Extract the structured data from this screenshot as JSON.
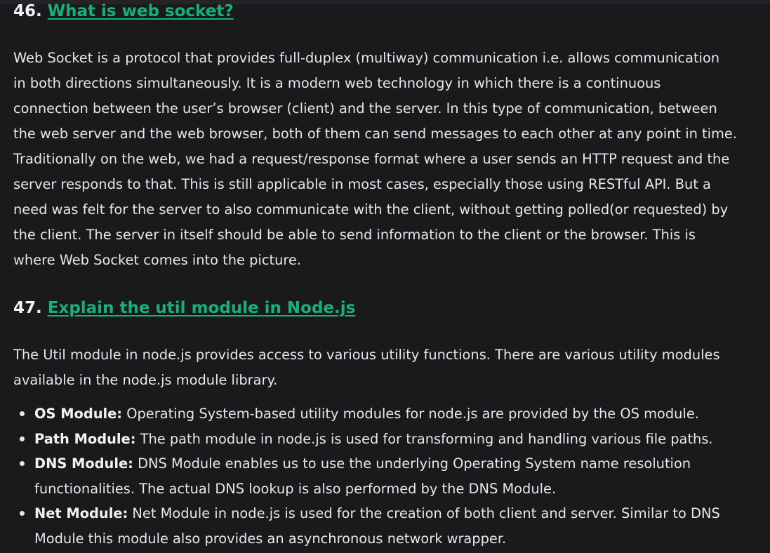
{
  "q46": {
    "number": "46.",
    "title": "What is web socket?",
    "lines": [
      "Web Socket is a protocol that provides full-duplex (multiway) communication i.e. allows communication",
      "in both directions simultaneously. It is a modern web technology in which there is a continuous",
      "connection between the user’s browser (client) and the server. In this type of communication, between",
      "the web server and the web browser, both of them can send messages to each other at any point in time.",
      "Traditionally on the web, we had a request/response format where a user sends an HTTP request and the",
      "server responds to that. This is still applicable in most cases, especially those using RESTful API. But a",
      "need was felt for the server to also communicate with the client, without getting polled(or requested) by",
      "the client. The server in itself should be able to send information to the client or the browser. This is",
      "where Web Socket comes into the picture."
    ]
  },
  "q47": {
    "number": "47.",
    "title": "Explain the util module in Node.js",
    "intro_lines": [
      "The Util module in node.js provides access to various utility functions. There are various utility modules",
      "available in the node.js module library."
    ],
    "items": [
      {
        "label": "OS Module:",
        "lines": [
          " Operating System-based utility modules for node.js are provided by the OS module."
        ]
      },
      {
        "label": "Path Module:",
        "lines": [
          " The path module in node.js is used for transforming and handling various file paths."
        ]
      },
      {
        "label": "DNS Module:",
        "lines": [
          " DNS Module enables us to use the underlying Operating System name resolution",
          "functionalities. The actual DNS lookup is also performed by the DNS Module."
        ]
      },
      {
        "label": "Net Module:",
        "lines": [
          " Net Module in node.js is used for the creation of both client and server. Similar to DNS",
          "Module this module also provides an asynchronous network wrapper."
        ]
      }
    ]
  },
  "colors": {
    "background": "#1a1a1d",
    "text": "#e7e7ea",
    "link": "#16b07a"
  }
}
